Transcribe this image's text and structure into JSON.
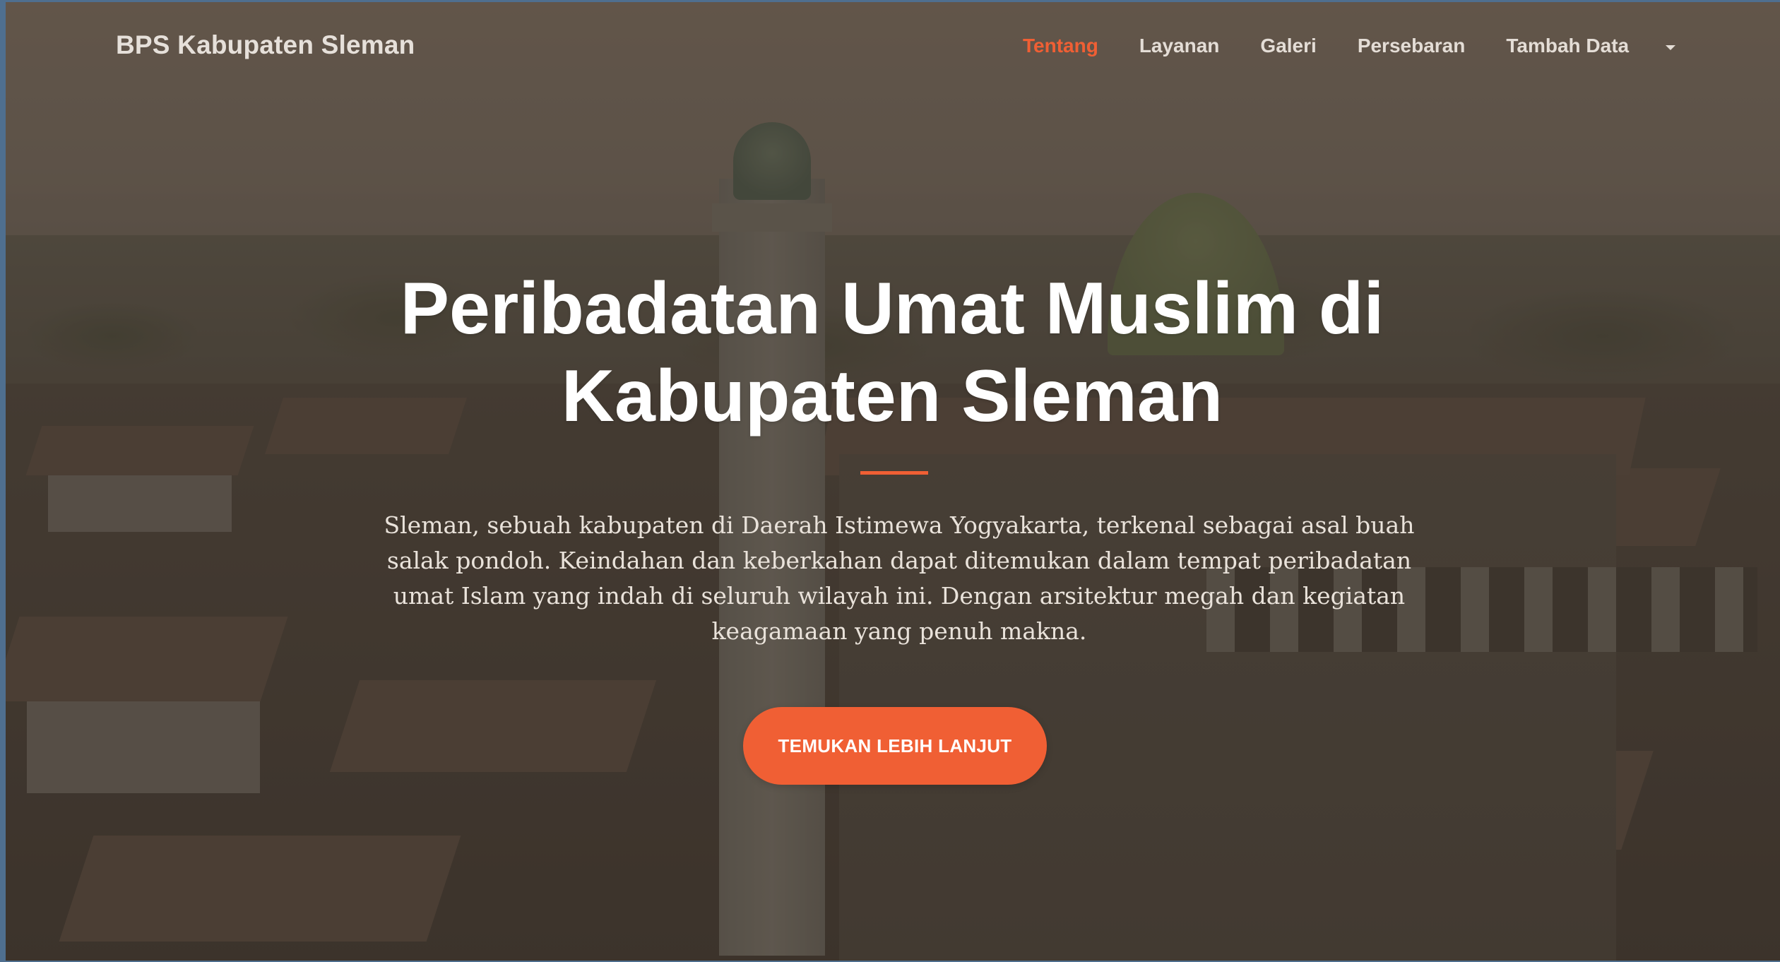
{
  "navbar": {
    "brand": "BPS Kabupaten Sleman",
    "links": [
      {
        "label": "Tentang",
        "active": true
      },
      {
        "label": "Layanan",
        "active": false
      },
      {
        "label": "Galeri",
        "active": false
      },
      {
        "label": "Persebaran",
        "active": false
      },
      {
        "label": "Tambah Data",
        "active": false
      }
    ],
    "dropdown_icon": "caret-down-icon"
  },
  "hero": {
    "title": "Peribadatan Umat Muslim di Kabupaten Sleman",
    "description": "Sleman, sebuah kabupaten di Daerah Istimewa Yogyakarta, terkenal sebagai asal buah salak pondoh. Keindahan dan keberkahan dapat ditemukan dalam tempat peribadatan umat Islam yang indah di seluruh wilayah ini. Dengan arsitektur megah dan kegiatan keagamaan yang penuh makna.",
    "cta_label": "TEMUKAN LEBIH LANJUT"
  },
  "colors": {
    "accent": "#f05f34",
    "text": "#ffffff"
  }
}
